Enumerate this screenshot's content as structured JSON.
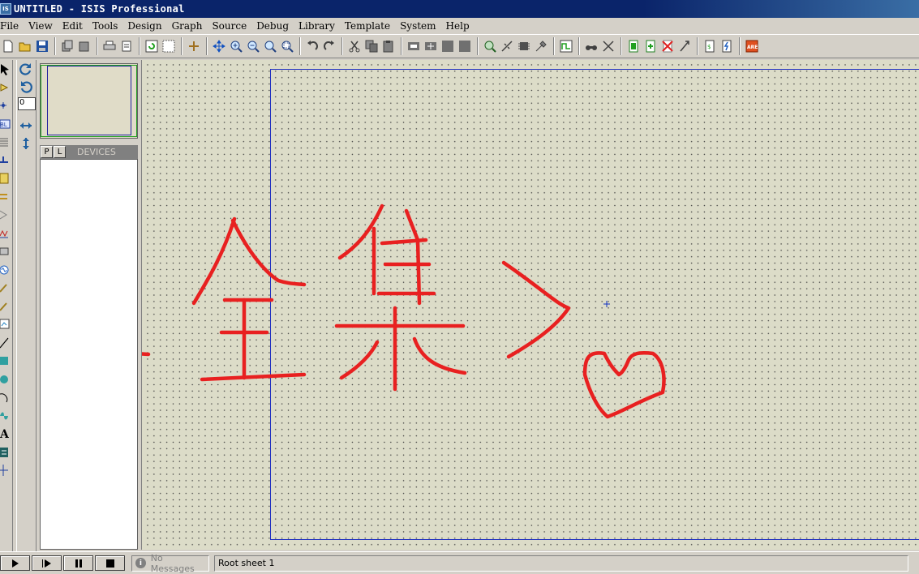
{
  "window": {
    "title": "UNTITLED - ISIS Professional",
    "app_icon": "isis-icon"
  },
  "menu": [
    "File",
    "View",
    "Edit",
    "Tools",
    "Design",
    "Graph",
    "Source",
    "Debug",
    "Library",
    "Template",
    "System",
    "Help"
  ],
  "toolbar_icons": [
    "new-file-icon",
    "open-folder-icon",
    "save-icon",
    "import-icon",
    "export-icon",
    "print-icon",
    "print-area-icon",
    "refresh-icon",
    "grid-icon",
    "origin-icon",
    "pan-icon",
    "zoom-in-icon",
    "zoom-out-icon",
    "zoom-all-icon",
    "zoom-area-icon",
    "undo-icon",
    "redo-icon",
    "cut-icon",
    "copy-icon",
    "paste-icon",
    "block-copy-icon",
    "block-move-icon",
    "block-rotate-icon",
    "block-delete-icon",
    "pick-device-icon",
    "make-device-icon",
    "package-icon",
    "decompose-icon",
    "wire-autoroute-icon",
    "search-tag-icon",
    "property-tool-icon",
    "new-sheet-icon",
    "add-sheet-icon",
    "remove-sheet-icon",
    "goto-child-icon",
    "bom-icon",
    "electrical-check-icon",
    "ares-netlist-icon"
  ],
  "rotation": {
    "angle": "0"
  },
  "devices": {
    "tab_p": "P",
    "tab_l": "L",
    "label": "DEVICES"
  },
  "status": {
    "messages": "No Messages",
    "sheet": "Root sheet 1"
  },
  "colors": {
    "ink": "#e82020",
    "sheet_border": "#2030c0",
    "canvas_bg": "#dcdcc8"
  },
  "annotation": {
    "text": "<全集>♡"
  }
}
